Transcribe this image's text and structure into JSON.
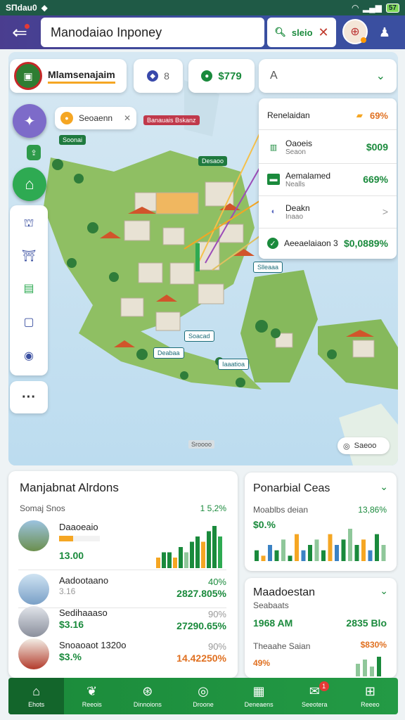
{
  "status_bar": {
    "time": "SПdau0",
    "battery": "57"
  },
  "top_bar": {
    "search_value": "Manodaiao Inponey",
    "search_button_label": "sleio",
    "search_button_icon": "search-icon"
  },
  "map": {
    "brand_name": "Mlamsenajaim",
    "stat1": "8",
    "stat2": "$779",
    "filter_value": "A",
    "poi_label": "Seoaenn",
    "tags": [
      "Banauais Bskanz",
      "Soonai",
      "Desaoo",
      "Slleaaa",
      "Soacad",
      "Deabaa",
      "Iaaatioa"
    ],
    "scale_label": "Sroooo",
    "location_label": "Saeoo"
  },
  "legend": {
    "header_label": "Renelaidan",
    "header_value": "69%",
    "items": [
      {
        "label": "Oaoeis",
        "sub": "Seaon",
        "value": "$009"
      },
      {
        "label": "Aemalamed",
        "sub": "Nealls",
        "value": "669%"
      },
      {
        "label": "Deakn",
        "sub": "Inaao",
        "value": ">"
      },
      {
        "label": "Aeeaelaiaon 3",
        "sub": "",
        "value": "$0,0889%"
      }
    ]
  },
  "destinations_card": {
    "title": "Manjabnat Alrdons",
    "subtitle": "Somaj Snos",
    "subtitle_value": "1 5,2%",
    "rows": [
      {
        "name": "Daaoeaio",
        "price": "13.00",
        "pct": "",
        "value": "",
        "progress": 0.35
      },
      {
        "name": "Aadootaano",
        "price": "3.16",
        "pct": "40%",
        "value": "2827.805%",
        "progress": 0
      },
      {
        "name": "Sedihaaaso",
        "price": "$3.16",
        "pct": "90%",
        "value": "27290.65%",
        "progress": 0
      },
      {
        "name": "Snoaoaot 1320o",
        "price": "$3.%",
        "pct": "90%",
        "value": "14.42250%",
        "progress": 0
      }
    ],
    "chart_values": [
      2,
      3,
      3,
      2,
      4,
      3,
      5,
      6,
      5,
      7,
      8,
      6
    ]
  },
  "potential_card": {
    "title": "Ponarbial Ceas",
    "label": "Moablbs deian",
    "label_value": "13,86%",
    "value": "$0.%",
    "chart_data": {
      "type": "bar",
      "values": [
        2,
        1,
        3,
        2,
        4,
        1,
        5,
        2,
        3,
        4,
        2,
        5,
        3,
        4,
        6,
        3,
        4,
        2,
        5,
        3
      ]
    }
  },
  "summary_card": {
    "title": "Maadoestan",
    "subtitle": "Seabaats",
    "left_value": "1968 AM",
    "right_value": "2835 Blo",
    "label2": "Theaahe Saian",
    "label2_value": "$830%",
    "pct": "49%"
  },
  "bottom_nav": {
    "items": [
      {
        "label": "Ehots",
        "icon": "home-icon"
      },
      {
        "label": "Reeois",
        "icon": "leaf-icon"
      },
      {
        "label": "Dinnoions",
        "icon": "basket-icon"
      },
      {
        "label": "Droone",
        "icon": "compass-icon"
      },
      {
        "label": "Deneaens",
        "icon": "book-icon"
      },
      {
        "label": "Seeotera",
        "icon": "tag-icon",
        "badge": "1"
      },
      {
        "label": "Reeeo",
        "icon": "grid-icon"
      }
    ]
  },
  "colors": {
    "primary_green": "#1a8a3c",
    "header_purple": "#4a3d8f",
    "accent_orange": "#f5a623"
  }
}
